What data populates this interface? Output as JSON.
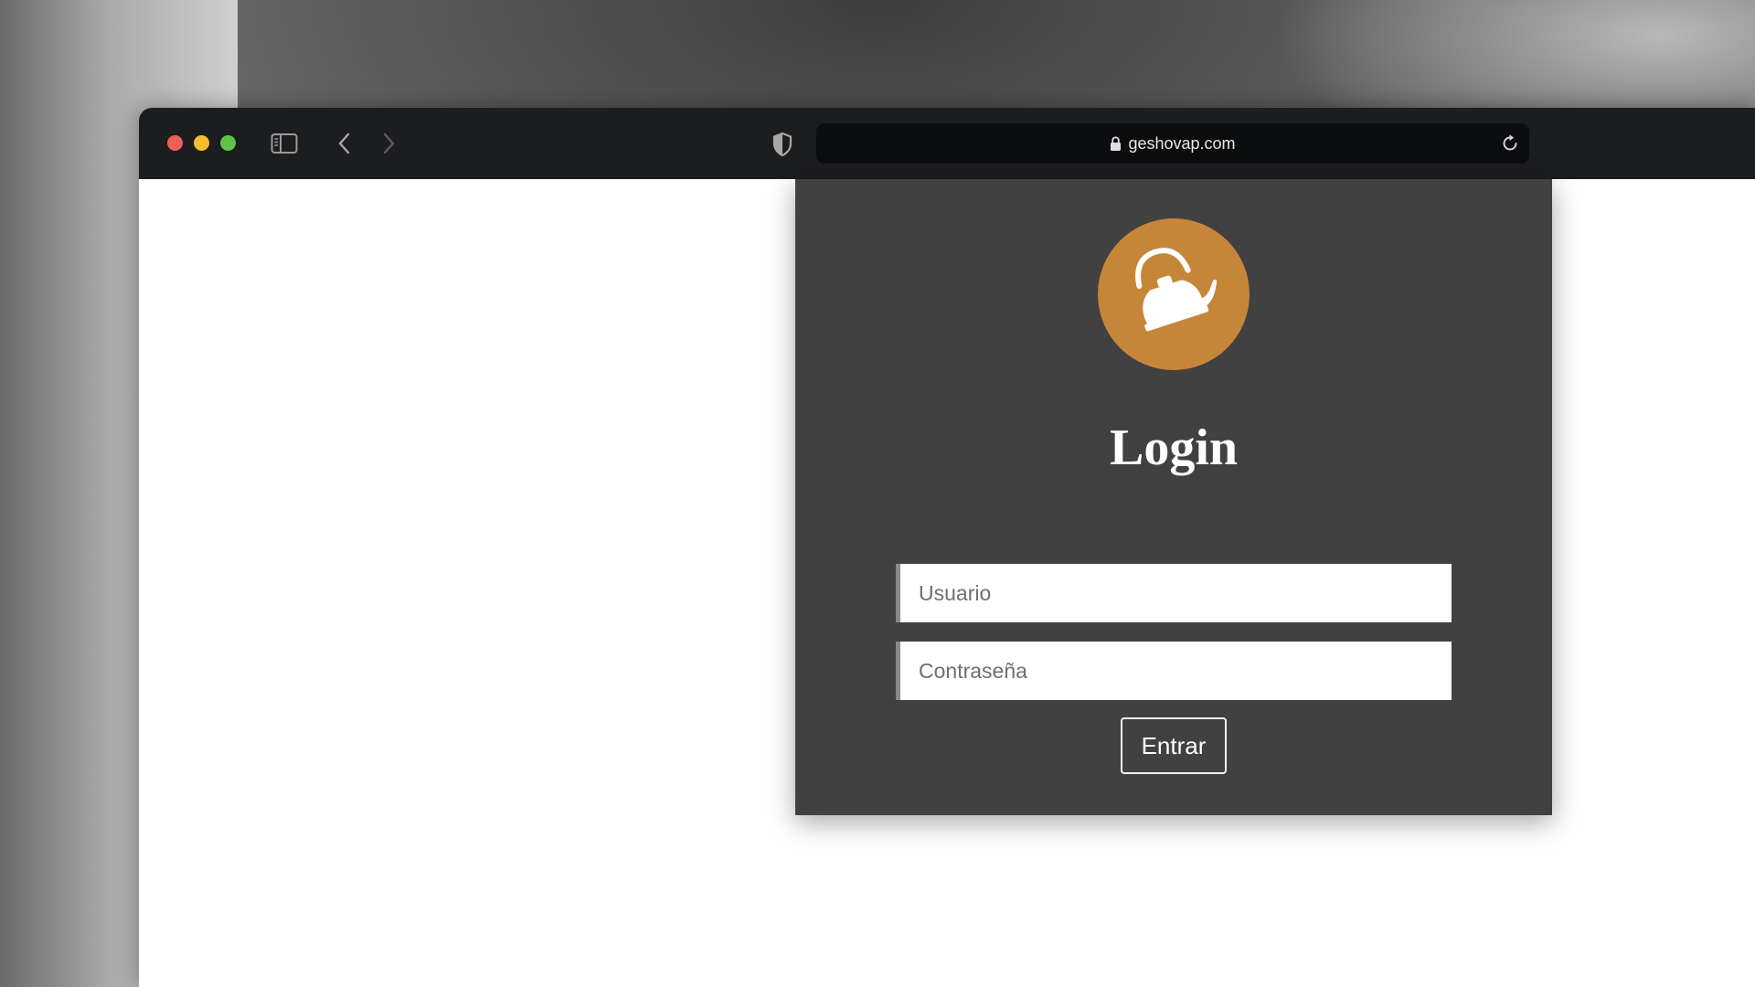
{
  "browser": {
    "url": "geshovap.com",
    "colors": {
      "toolbar": "#1c1d1f",
      "urlbar": "#0c0d0f",
      "close": "#ee5f57",
      "minimize": "#f6bd2f",
      "maximize": "#5fc54a"
    },
    "icons": {
      "sidebar": "sidebar-icon",
      "back": "chevron-left-icon",
      "forward": "chevron-right-icon",
      "privacy": "shield-icon",
      "lock": "lock-icon",
      "reload": "reload-icon"
    }
  },
  "login": {
    "logo_icon": "kettle-icon",
    "title": "Login",
    "username_placeholder": "Usuario",
    "password_placeholder": "Contraseña",
    "submit_label": "Entrar",
    "colors": {
      "card": "#414141",
      "logo_circle": "#c6863a",
      "text": "#ffffff"
    }
  }
}
